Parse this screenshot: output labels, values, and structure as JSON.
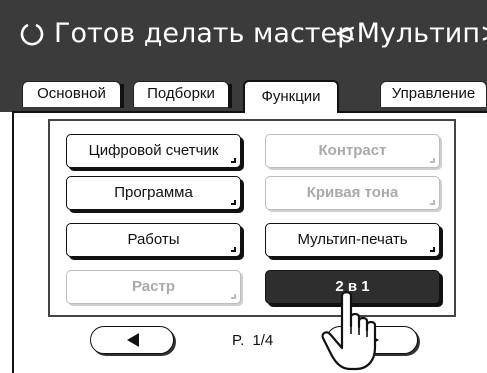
{
  "header": {
    "status": "Готов делать мастер",
    "mode": "<Мультип>"
  },
  "tabs": [
    {
      "label": "Основной",
      "active": false
    },
    {
      "label": "Подборки",
      "active": false
    },
    {
      "label": "Функции",
      "active": true
    },
    {
      "label": "Управление",
      "active": false
    }
  ],
  "functions": {
    "digital_counter": "Цифровой счетчик",
    "contrast": "Контраст",
    "program": "Программа",
    "tone_curve": "Кривая тона",
    "jobs": "Работы",
    "multi_up": "Мультип-печать",
    "screen": "Растр",
    "two_up": "2 в 1"
  },
  "pagination": {
    "page_label": "P.",
    "page": "1/4"
  },
  "colors": {
    "header_bg": "#3b3b3b",
    "selected_bg": "#2e2e2e",
    "disabled_text": "#aaaaaa"
  },
  "icons": {
    "status": "circle-outline-icon",
    "prev": "triangle-left-icon",
    "next": "triangle-right-icon",
    "pointer": "hand-pointer-icon"
  }
}
